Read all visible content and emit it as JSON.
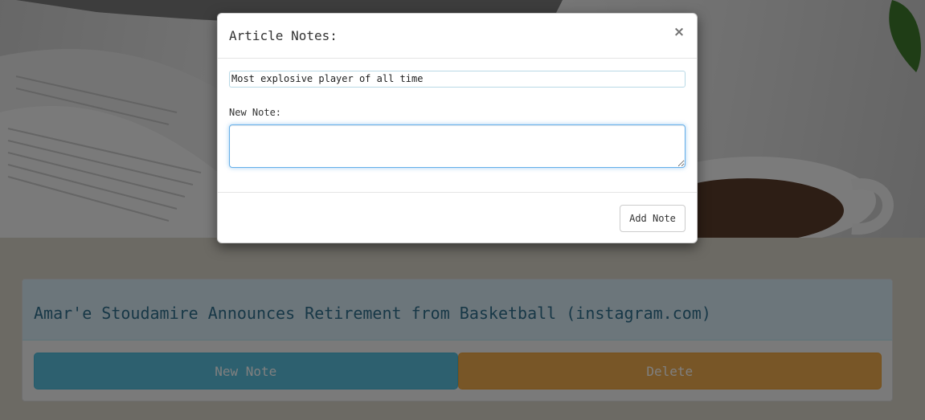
{
  "article": {
    "title": "Amar'e Stoudamire Announces Retirement from Basketball (instagram.com)",
    "new_note_label": "New Note",
    "delete_label": "Delete"
  },
  "modal": {
    "title": "Article Notes:",
    "close_symbol": "×",
    "existing_note": "Most explosive player of all time",
    "new_note_label": "New Note:",
    "new_note_value": "",
    "add_button_label": "Add Note"
  },
  "colors": {
    "info": "#5bc0de",
    "warning": "#f0ad4e",
    "panel_heading_bg": "#d9edf7",
    "panel_title": "#31708f"
  }
}
